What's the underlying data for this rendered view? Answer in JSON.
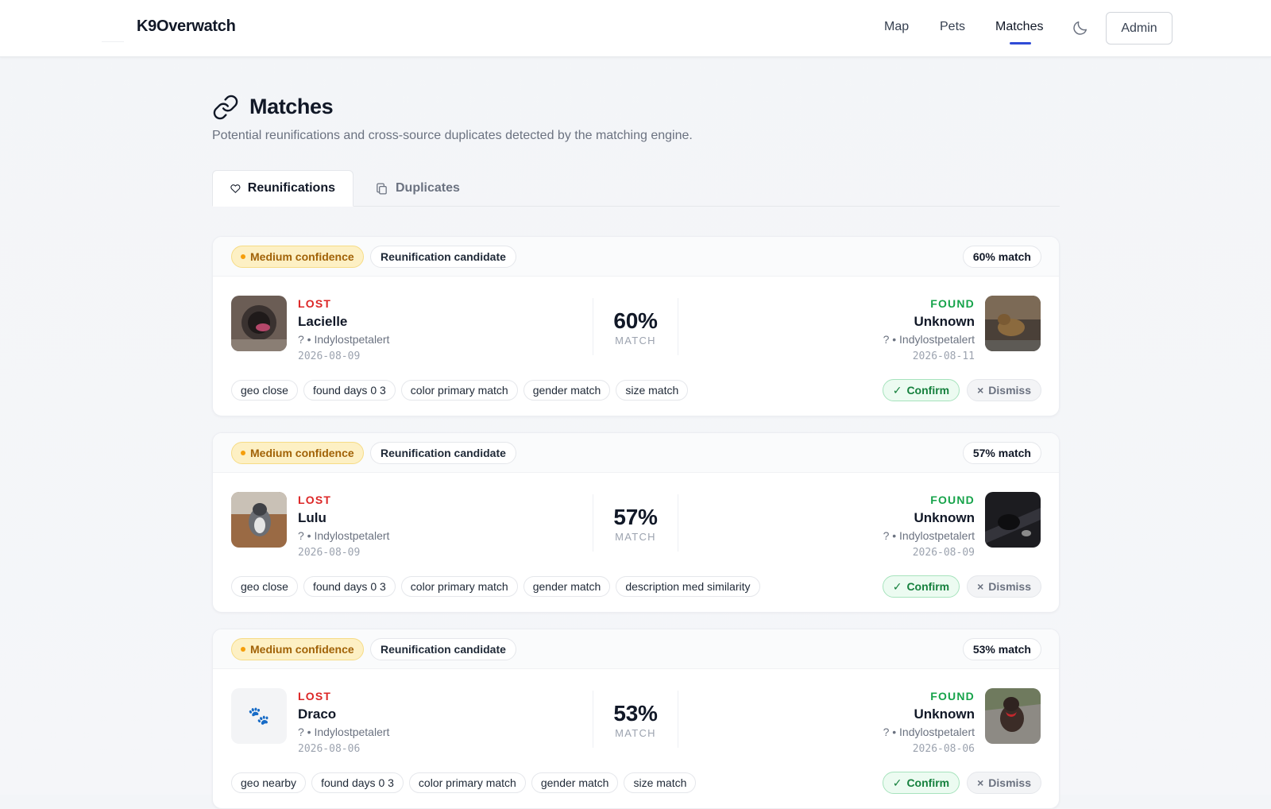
{
  "app": {
    "brand": "K9Overwatch"
  },
  "nav": {
    "map": "Map",
    "pets": "Pets",
    "matches": "Matches",
    "admin": "Admin"
  },
  "page": {
    "title": "Matches",
    "subtitle": "Potential reunifications and cross-source duplicates detected by the matching engine."
  },
  "tabs": {
    "reunifications": "Reunifications",
    "duplicates": "Duplicates",
    "active": "Reunifications"
  },
  "labels": {
    "lost": "LOST",
    "found": "FOUND",
    "match": "MATCH",
    "confirm": "Confirm",
    "dismiss": "Dismiss"
  },
  "colors": {
    "accent": "#2f4bd6",
    "lost": "#dc2626",
    "found": "#16a34a",
    "confidence_medium": "#a16207"
  },
  "matches": [
    {
      "confidence": "Medium confidence",
      "kind": "Reunification candidate",
      "match_badge": "60% match",
      "score": "60%",
      "lost": {
        "name": "Lacielle",
        "meta": "? • Indylostpetalert",
        "date": "2026-08-09",
        "photo": "photo"
      },
      "found": {
        "name": "Unknown",
        "meta": "? • Indylostpetalert",
        "date": "2026-08-11",
        "photo": "photo"
      },
      "reasons": [
        "geo close",
        "found days 0 3",
        "color primary match",
        "gender match",
        "size match"
      ]
    },
    {
      "confidence": "Medium confidence",
      "kind": "Reunification candidate",
      "match_badge": "57% match",
      "score": "57%",
      "lost": {
        "name": "Lulu",
        "meta": "? • Indylostpetalert",
        "date": "2026-08-09",
        "photo": "photo"
      },
      "found": {
        "name": "Unknown",
        "meta": "? • Indylostpetalert",
        "date": "2026-08-09",
        "photo": "photo"
      },
      "reasons": [
        "geo close",
        "found days 0 3",
        "color primary match",
        "gender match",
        "description med similarity"
      ]
    },
    {
      "confidence": "Medium confidence",
      "kind": "Reunification candidate",
      "match_badge": "53% match",
      "score": "53%",
      "lost": {
        "name": "Draco",
        "meta": "? • Indylostpetalert",
        "date": "2026-08-06",
        "photo": "paw-placeholder-icon"
      },
      "found": {
        "name": "Unknown",
        "meta": "? • Indylostpetalert",
        "date": "2026-08-06",
        "photo": "photo"
      },
      "reasons": [
        "geo nearby",
        "found days 0 3",
        "color primary match",
        "gender match",
        "size match"
      ]
    }
  ]
}
